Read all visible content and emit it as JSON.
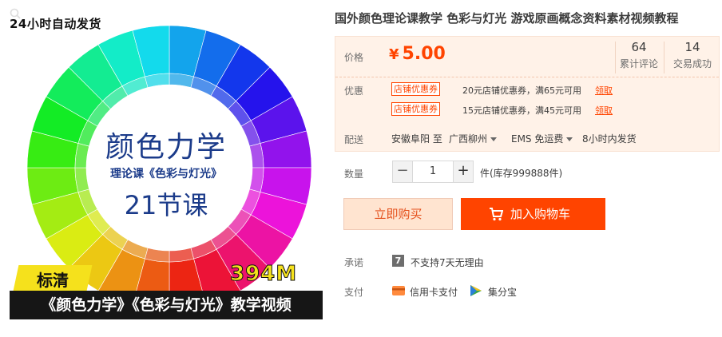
{
  "image": {
    "badge": "24小时自动发货",
    "title": "颜色力学",
    "subtitle": "理论课《色彩与灯光》",
    "lesson_count": "21节课",
    "quality": "标清",
    "file_size": "394M",
    "caption": "《颜色力学》《色彩与灯光》教学视频"
  },
  "product": {
    "title": "国外颜色理论课教学 色彩与灯光 游戏原画概念资料素材视频教程"
  },
  "price": {
    "label": "价格",
    "currency": "¥",
    "value": "5.00",
    "reviews_count": "64",
    "reviews_label": "累计评论",
    "deals_count": "14",
    "deals_label": "交易成功"
  },
  "coupons": {
    "label": "优惠",
    "items": [
      {
        "tag": "店铺优惠券",
        "text": "20元店铺优惠券，满65元可用",
        "action": "领取"
      },
      {
        "tag": "店铺优惠券",
        "text": "15元店铺优惠券，满45元可用",
        "action": "领取"
      }
    ]
  },
  "shipping": {
    "label": "配送",
    "from": "安徽阜阳 至",
    "to": "广西柳州",
    "method": "EMS 免运费",
    "time": "8小时内发货"
  },
  "quantity": {
    "label": "数量",
    "minus": "−",
    "value": "1",
    "plus": "+",
    "stock": "件(库存999888件)"
  },
  "actions": {
    "buy_now": "立即购买",
    "add_to_cart": "加入购物车"
  },
  "promise": {
    "label": "承诺",
    "icon_glyph": "7",
    "text": "不支持7天无理由"
  },
  "payment": {
    "label": "支付",
    "methods": [
      "信用卡支付",
      "集分宝"
    ]
  },
  "colors": {
    "accent": "#ff4400",
    "price_bg": "#fff2e8",
    "title_blue": "#1b3b8a"
  }
}
